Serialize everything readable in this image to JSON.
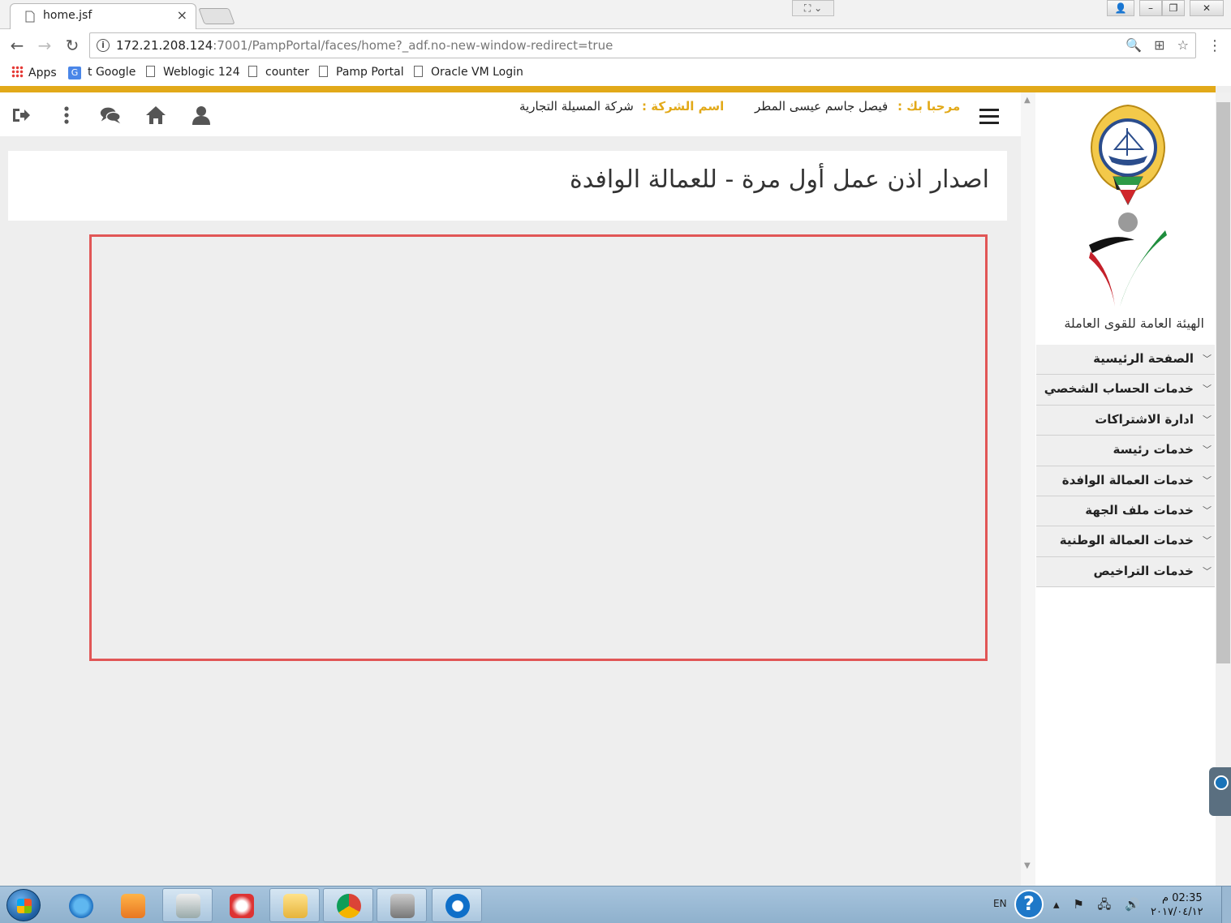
{
  "browser": {
    "tab_title": "home.jsf",
    "tab_close": "×",
    "url_host": "172.21.208.124",
    "url_rest": ":7001/PampPortal/faces/home?_adf.no-new-window-redirect=true",
    "bookmarks": [
      {
        "label": "Apps",
        "icon": "apps-grid-icon"
      },
      {
        "label": "t Google",
        "icon": "google-translate-icon"
      },
      {
        "label": "Weblogic 124",
        "icon": "page-icon"
      },
      {
        "label": "counter",
        "icon": "page-icon"
      },
      {
        "label": "Pamp Portal",
        "icon": "page-icon"
      },
      {
        "label": "Oracle VM Login",
        "icon": "page-icon"
      }
    ]
  },
  "header": {
    "welcome_label": "مرحبا بك :",
    "user_name": "فيصل جاسم عيسى المطر",
    "company_label": "اسم الشركة :",
    "company_name": "شركة المسيلة التجارية",
    "icons": [
      "logout-icon",
      "more-vertical-icon",
      "chat-icon",
      "home-icon",
      "user-icon"
    ],
    "accent_color": "#e2a919"
  },
  "page": {
    "title": "اصدار اذن عمل أول مرة - للعمالة الوافدة",
    "frame_border_color": "#e15656"
  },
  "sidebar": {
    "org_name": "الهيئة العامة للقوى العاملة",
    "menu": [
      {
        "label": "الصفحة الرئيسية"
      },
      {
        "label": "خدمات الحساب الشخصي"
      },
      {
        "label": "ادارة الاشتراكات"
      },
      {
        "label": "خدمات رئيسة"
      },
      {
        "label": "خدمات العمالة الوافدة"
      },
      {
        "label": "خدمات ملف الجهة"
      },
      {
        "label": "خدمات العمالة الوطنية"
      },
      {
        "label": "خدمات التراخيص"
      }
    ]
  },
  "taskbar": {
    "language": "EN",
    "time": "02:35 م",
    "date": "٢٠١٧/٠٤/١٢"
  }
}
